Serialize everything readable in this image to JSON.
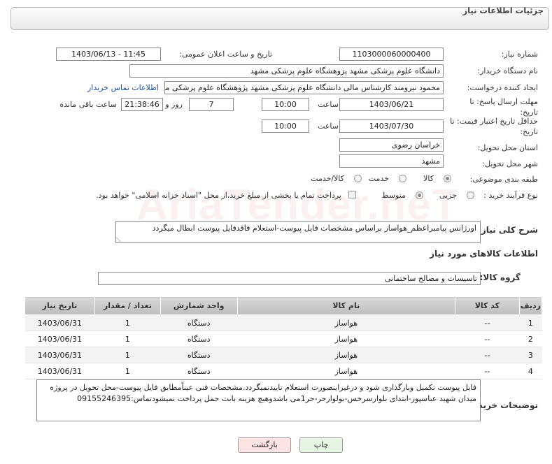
{
  "header": {
    "title": "جزئیات اطلاعات نیاز"
  },
  "fields": {
    "need_number_label": "شماره نیاز:",
    "need_number": "1103000060000400",
    "announce_label": "تاریخ و ساعت اعلان عمومی:",
    "announce_value": "1403/06/13 - 11:45",
    "buyer_org_label": "نام دستگاه خریدار:",
    "buyer_org": "دانشگاه علوم پزشکی مشهد   پژوهشگاه علوم پزشکی مشهد",
    "requester_label": "ایجاد کننده درخواست:",
    "requester": "محمود نیرومند کارشناس مالی دانشگاه علوم پزشکی مشهد   پژوهشگاه علوم پزشکی مشهد",
    "contact_link": "اطلاعات تماس خریدار",
    "deadline_label": "مهلت ارسال پاسخ: تا تاریخ:",
    "deadline_date": "1403/06/21",
    "time_label": "ساعت",
    "deadline_time": "10:00",
    "days_value": "7",
    "days_label": "روز و",
    "remaining_time": "21:38:46",
    "remaining_label": "ساعت باقی مانده",
    "validity_label": "حداقل تاریخ اعتبار قیمت: تا تاریخ:",
    "validity_date": "1403/07/30",
    "validity_time": "10:00",
    "province_label": "استان محل تحویل:",
    "province": "خراسان رضوی",
    "city_label": "شهر محل تحویل:",
    "city": "مشهد",
    "category_label": "طبقه بندی موضوعی:",
    "category_options": [
      "کالا",
      "خدمت",
      "کالا/خدمت"
    ],
    "process_label": "نوع فرآیند خرید :",
    "process_options": [
      "جزیی",
      "متوسط"
    ],
    "payment_note": "پرداخت تمام یا بخشی از مبلغ خرید،از محل \"اسناد خزانه اسلامی\" خواهد بود."
  },
  "description": {
    "label": "شرح کلی نیاز:",
    "text": "اورژانس پیامبراعظم_هواساز براساس مشخصات فایل پیوست-استعلام فاقدفایل پیوست ابطال میگردد"
  },
  "goods_section": {
    "title": "اطلاعات کالاهای مورد نیاز",
    "group_label": "گروه کالا:",
    "group_value": "تاسیسات و مصالح ساختمانی"
  },
  "table": {
    "headers": [
      "ردیف",
      "کد کالا",
      "نام کالا",
      "واحد شمارش",
      "تعداد / مقدار",
      "تاریخ نیاز"
    ],
    "rows": [
      [
        "1",
        "--",
        "هواساز",
        "دستگاه",
        "1",
        "1403/06/31"
      ],
      [
        "2",
        "--",
        "هواساز",
        "دستگاه",
        "1",
        "1403/06/31"
      ],
      [
        "3",
        "--",
        "هواساز",
        "دستگاه",
        "1",
        "1403/06/31"
      ],
      [
        "4",
        "--",
        "هواساز",
        "دستگاه",
        "1",
        "1403/06/31"
      ]
    ]
  },
  "buyer_notes": {
    "label": "توضیحات خریدار:",
    "text": "فایل پیوست تکمیل وبارگذاری شود و درغیراینصورت استعلام تاییدنمیگردد.مشخصات فنی عیناًمطابق فایل پیوست-محل تحویل در پروژه میدان شهید عباسپور-ابتدای بلوارسرخس-بولوارحر-حر1می باشدوهیچ هزینه بابت حمل  پرداخت نمیشودتماس:09155246395"
  },
  "buttons": {
    "print": "چاپ",
    "back": "بازگشت"
  },
  "watermark": "AriaTender.neT",
  "colors": {
    "link": "#1a4fa0",
    "back_button": "#fde3e3",
    "print_button": "#e6f5e1"
  }
}
